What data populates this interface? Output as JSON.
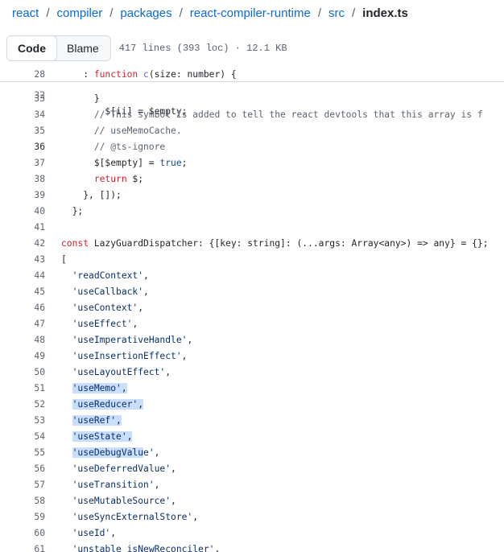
{
  "breadcrumb": {
    "items": [
      "react",
      "compiler",
      "packages",
      "react-compiler-runtime",
      "src"
    ],
    "separator": "/",
    "current": "index.ts"
  },
  "toolbar": {
    "code_label": "Code",
    "blame_label": "Blame",
    "file_meta": "417 lines (393 loc) · 12.1 KB"
  },
  "sticky_line": {
    "num": "28",
    "text": "    : function c(size: number) {"
  },
  "ghost_line": {
    "num": "32",
    "text": "        $[ii] = $empty;"
  },
  "code_lines": [
    {
      "num": "33",
      "indent": "      ",
      "tokens": [
        {
          "t": "}",
          "c": ""
        }
      ]
    },
    {
      "num": "34",
      "indent": "      ",
      "tokens": [
        {
          "t": "// This symbol is added to tell the react devtools that this array is f",
          "c": "com"
        }
      ]
    },
    {
      "num": "35",
      "indent": "      ",
      "tokens": [
        {
          "t": "// useMemoCache.",
          "c": "com"
        }
      ]
    },
    {
      "num": "36",
      "indent": "      ",
      "tokens": [
        {
          "t": "// @ts-ignore",
          "c": "com"
        }
      ]
    },
    {
      "num": "37",
      "indent": "      ",
      "tokens": [
        {
          "t": "$[$empty] = ",
          "c": ""
        },
        {
          "t": "true",
          "c": "con"
        },
        {
          "t": ";",
          "c": ""
        }
      ]
    },
    {
      "num": "38",
      "indent": "      ",
      "tokens": [
        {
          "t": "return",
          "c": "kw"
        },
        {
          "t": " $;",
          "c": ""
        }
      ]
    },
    {
      "num": "39",
      "indent": "    ",
      "tokens": [
        {
          "t": "}, []);",
          "c": ""
        }
      ]
    },
    {
      "num": "40",
      "indent": "  ",
      "tokens": [
        {
          "t": "};",
          "c": ""
        }
      ]
    },
    {
      "num": "41",
      "indent": "",
      "tokens": []
    },
    {
      "num": "42",
      "indent": "",
      "tokens": [
        {
          "t": "const",
          "c": "kw"
        },
        {
          "t": " LazyGuardDispatcher: {[key: string]: (...args: Array<any>) => any} = {};",
          "c": ""
        }
      ]
    },
    {
      "num": "43",
      "indent": "",
      "tokens": [
        {
          "t": "[",
          "c": ""
        }
      ]
    },
    {
      "num": "44",
      "indent": "  ",
      "tokens": [
        {
          "t": "'readContext'",
          "c": "str"
        },
        {
          "t": ",",
          "c": ""
        }
      ]
    },
    {
      "num": "45",
      "indent": "  ",
      "tokens": [
        {
          "t": "'useCallback'",
          "c": "str"
        },
        {
          "t": ",",
          "c": ""
        }
      ]
    },
    {
      "num": "46",
      "indent": "  ",
      "tokens": [
        {
          "t": "'useContext'",
          "c": "str"
        },
        {
          "t": ",",
          "c": ""
        }
      ]
    },
    {
      "num": "47",
      "indent": "  ",
      "tokens": [
        {
          "t": "'useEffect'",
          "c": "str"
        },
        {
          "t": ",",
          "c": ""
        }
      ]
    },
    {
      "num": "48",
      "indent": "  ",
      "tokens": [
        {
          "t": "'useImperativeHandle'",
          "c": "str"
        },
        {
          "t": ",",
          "c": ""
        }
      ]
    },
    {
      "num": "49",
      "indent": "  ",
      "tokens": [
        {
          "t": "'useInsertionEffect'",
          "c": "str"
        },
        {
          "t": ",",
          "c": ""
        }
      ]
    },
    {
      "num": "50",
      "indent": "  ",
      "tokens": [
        {
          "t": "'useLayoutEffect'",
          "c": "str"
        },
        {
          "t": ",",
          "c": ""
        }
      ]
    },
    {
      "num": "51",
      "indent": "  ",
      "tokens": [
        {
          "t": "'useMemo'",
          "c": "str"
        },
        {
          "t": ",",
          "c": ""
        }
      ],
      "hl": "full"
    },
    {
      "num": "52",
      "indent": "  ",
      "tokens": [
        {
          "t": "'useReducer'",
          "c": "str"
        },
        {
          "t": ",",
          "c": ""
        }
      ],
      "hl": "full"
    },
    {
      "num": "53",
      "indent": "  ",
      "tokens": [
        {
          "t": "'useRef'",
          "c": "str"
        },
        {
          "t": ",",
          "c": ""
        }
      ],
      "hl": "full"
    },
    {
      "num": "54",
      "indent": "  ",
      "tokens": [
        {
          "t": "'useState'",
          "c": "str"
        },
        {
          "t": ",",
          "c": ""
        }
      ],
      "hl": "full"
    },
    {
      "num": "55",
      "indent": "  ",
      "tokens": [
        {
          "t": "'useDebugValu",
          "c": "str",
          "hl": true
        },
        {
          "t": "e'",
          "c": "str"
        },
        {
          "t": ",",
          "c": ""
        }
      ],
      "hl": "partial"
    },
    {
      "num": "56",
      "indent": "  ",
      "tokens": [
        {
          "t": "'useDeferredValue'",
          "c": "str"
        },
        {
          "t": ",",
          "c": ""
        }
      ]
    },
    {
      "num": "57",
      "indent": "  ",
      "tokens": [
        {
          "t": "'useTransition'",
          "c": "str"
        },
        {
          "t": ",",
          "c": ""
        }
      ]
    },
    {
      "num": "58",
      "indent": "  ",
      "tokens": [
        {
          "t": "'useMutableSource'",
          "c": "str"
        },
        {
          "t": ",",
          "c": ""
        }
      ]
    },
    {
      "num": "59",
      "indent": "  ",
      "tokens": [
        {
          "t": "'useSyncExternalStore'",
          "c": "str"
        },
        {
          "t": ",",
          "c": ""
        }
      ]
    },
    {
      "num": "60",
      "indent": "  ",
      "tokens": [
        {
          "t": "'useId'",
          "c": "str"
        },
        {
          "t": ",",
          "c": ""
        }
      ]
    },
    {
      "num": "61",
      "indent": "  ",
      "tokens": [
        {
          "t": "'unstable_isNewReconciler'",
          "c": "str"
        },
        {
          "t": ",",
          "c": ""
        }
      ]
    }
  ],
  "current_line": "36",
  "colors": {
    "link": "#0969da",
    "keyword": "#cf222e",
    "function": "#8250df",
    "string": "#0a3069",
    "comment": "#59636e",
    "constant": "#0550ae",
    "selection": "#c8defc"
  }
}
